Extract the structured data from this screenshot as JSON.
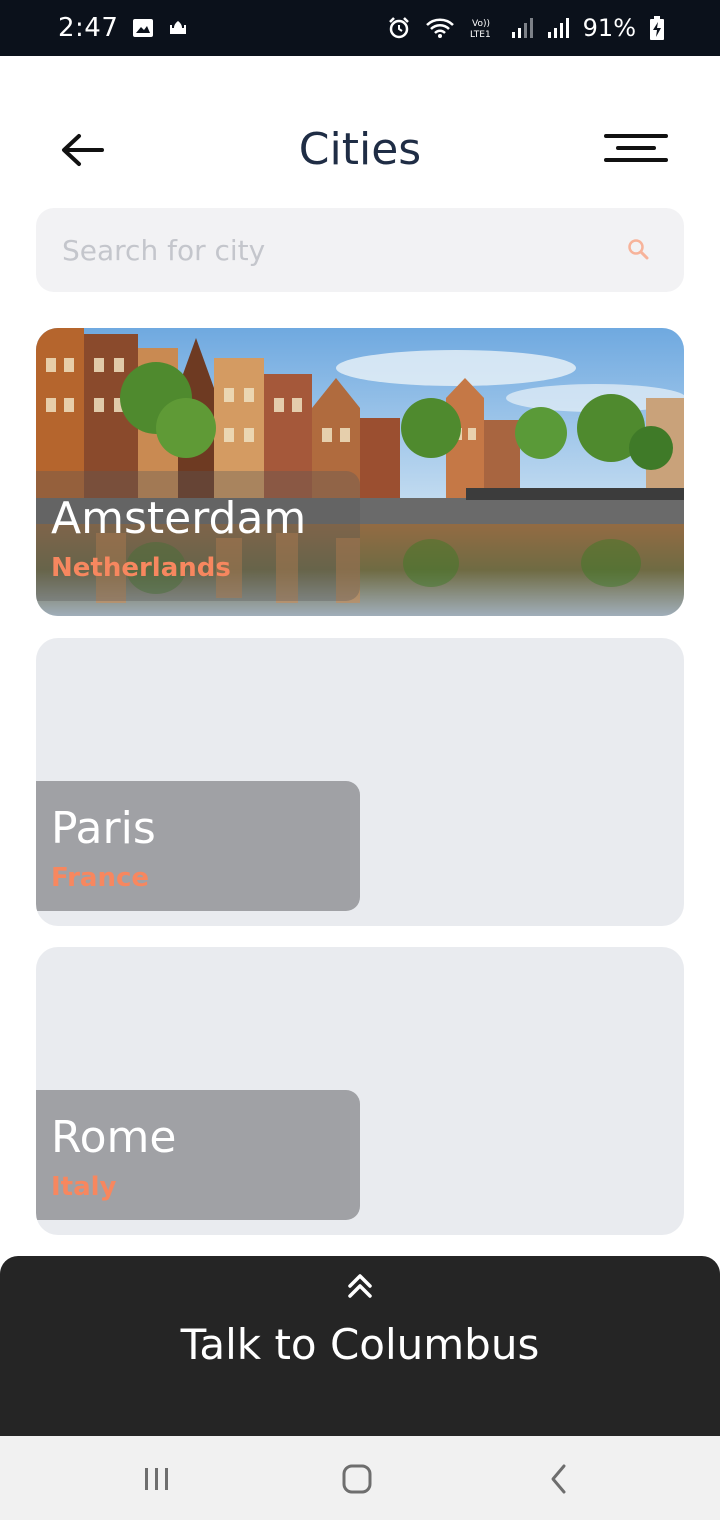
{
  "status_bar": {
    "time": "2:47",
    "battery": "91%",
    "icons": [
      "image-icon",
      "mosque-icon",
      "alarm-icon",
      "wifi-icon",
      "volte-icon",
      "signal-icon",
      "signal-icon",
      "battery-charging-icon"
    ]
  },
  "header": {
    "title": "Cities",
    "back_icon": "arrow-left-icon",
    "menu_icon": "menu-icon"
  },
  "search": {
    "placeholder": "Search for city",
    "value": "",
    "icon": "search-icon",
    "icon_color": "#f7b39a"
  },
  "cities": [
    {
      "name": "Amsterdam",
      "country": "Netherlands",
      "image": "amsterdam-canal-photo"
    },
    {
      "name": "Paris",
      "country": "France"
    },
    {
      "name": "Rome",
      "country": "Italy"
    }
  ],
  "talk_bar": {
    "label": "Talk to Columbus",
    "icon": "double-chevron-up-icon"
  },
  "nav_bar": {
    "icons": [
      "recents-icon",
      "home-icon",
      "back-icon"
    ]
  },
  "colors": {
    "title": "#1f2d45",
    "accent": "#f7875f",
    "talk_bar_bg": "#252525",
    "card_placeholder": "#e9ebef",
    "label_panel": "#a0a1a5"
  }
}
